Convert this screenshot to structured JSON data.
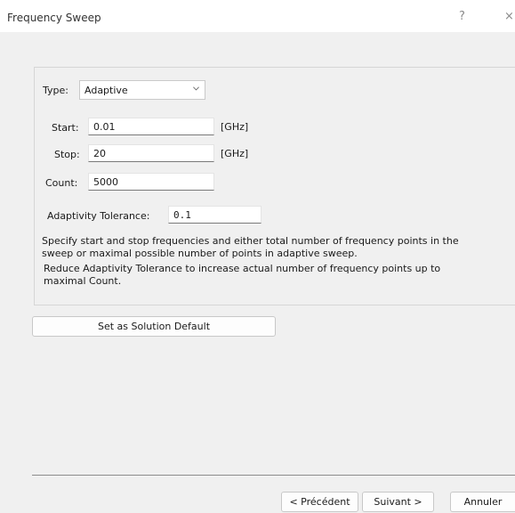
{
  "window": {
    "title": "Frequency Sweep",
    "help_label": "?",
    "close_label": "×"
  },
  "form": {
    "type_label": "Type:",
    "type_value": "Adaptive",
    "start_label": "Start:",
    "start_value": "0.01",
    "start_unit": "[GHz]",
    "stop_label": "Stop:",
    "stop_value": "20",
    "stop_unit": "[GHz]",
    "count_label": "Count:",
    "count_value": "5000",
    "tolerance_label": "Adaptivity Tolerance:",
    "tolerance_value": "0.1",
    "desc_line1": "Specify start and stop frequencies and either total number of frequency points in the",
    "desc_line2": "sweep or maximal possible number of points in adaptive sweep.",
    "desc_line3": "Reduce Adaptivity Tolerance to increase actual number of frequency points up to",
    "desc_line4": "maximal Count."
  },
  "buttons": {
    "set_default": "Set as Solution Default",
    "previous": "< Précédent",
    "next": "Suivant >",
    "cancel": "Annuler"
  },
  "icons": {
    "dropdown": "chevron-down-icon",
    "help": "help-icon",
    "close": "close-icon"
  }
}
